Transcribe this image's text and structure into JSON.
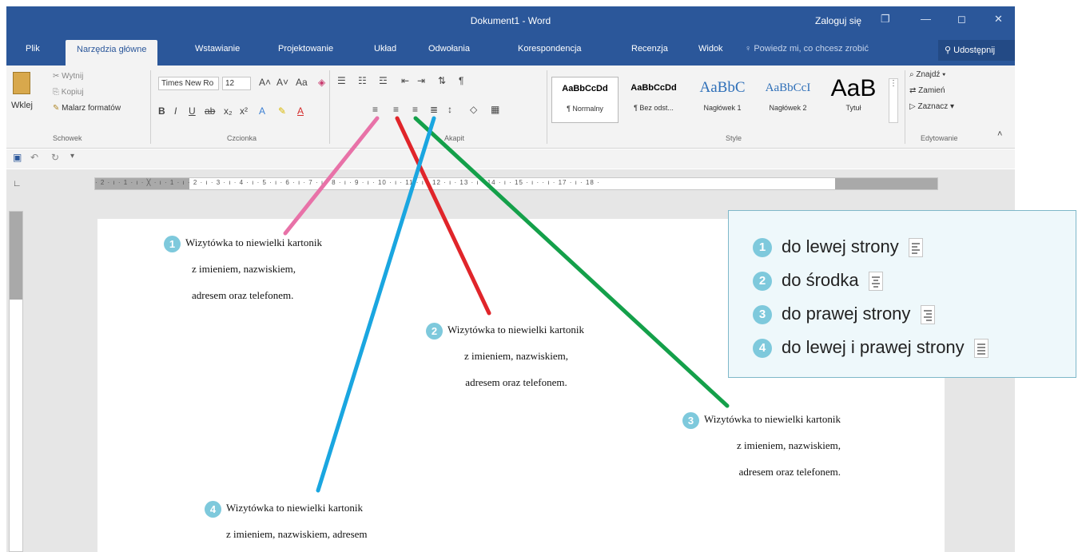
{
  "titlebar": {
    "title": "Dokument1  -  Word",
    "login": "Zaloguj się",
    "restore": "❐",
    "minimize": "—",
    "maximize": "◻",
    "close": "✕"
  },
  "tabs": [
    "Plik",
    "Narzędzia główne",
    "Wstawianie",
    "Projektowanie",
    "Układ",
    "Odwołania",
    "Korespondencja",
    "Recenzja",
    "Widok"
  ],
  "tell_me": "Powiedz mi, co chcesz zrobić",
  "share": "Udostępnij",
  "ribbon": {
    "clipboard": {
      "paste": "Wklej",
      "cut": "Wytnij",
      "copy": "Kopiuj",
      "painter": "Malarz formatów",
      "group": "Schowek"
    },
    "font": {
      "name": "Times New Ro",
      "size": "12",
      "group": "Czcionka"
    },
    "paragraph": {
      "group": "Akapit"
    },
    "styles": {
      "group": "Style",
      "items": [
        {
          "sample": "AaBbCcDd",
          "name": "¶ Normalny"
        },
        {
          "sample": "AaBbCcDd",
          "name": "¶ Bez odst..."
        },
        {
          "sample": "AaBbC",
          "name": "Nagłówek 1"
        },
        {
          "sample": "AaBbCcI",
          "name": "Nagłówek 2"
        },
        {
          "sample": "AaB",
          "name": "Tytuł"
        }
      ]
    },
    "editing": {
      "find": "Znajdź",
      "replace": "Zamień",
      "select": "Zaznacz",
      "group": "Edytowanie"
    }
  },
  "ruler_numbers": "· 2 · ı · 1 · ı · ╳ · ı · 1 · ı · 2 · ı · 3 · ı · 4 · ı · 5 · ı · 6 · ı · 7 · ı · 8 · ı · 9 · ı · 10 · ı · 11 · ı · 12 · ı · 13 · ı · 14 · ı · 15 · ı ·   · ı · 17 · ı · 18 ·",
  "paragraphs": [
    {
      "num": "1",
      "lines": [
        "Wizytówka to niewielki kartonik",
        "z imieniem, nazwiskiem,",
        "adresem oraz telefonem."
      ]
    },
    {
      "num": "2",
      "lines": [
        "Wizytówka to niewielki kartonik",
        "z imieniem, nazwiskiem,",
        "adresem oraz telefonem."
      ]
    },
    {
      "num": "3",
      "lines": [
        "Wizytówka to niewielki kartonik",
        "z imieniem, nazwiskiem,",
        "adresem oraz telefonem."
      ]
    },
    {
      "num": "4",
      "lines": [
        "Wizytówka  to  niewielki  kartonik",
        "z imieniem,  nazwiskiem,  adresem"
      ]
    }
  ],
  "legend": [
    {
      "num": "1",
      "text": "do lewej strony"
    },
    {
      "num": "2",
      "text": "do środka"
    },
    {
      "num": "3",
      "text": "do prawej strony"
    },
    {
      "num": "4",
      "text": "do lewej i prawej strony"
    }
  ],
  "colors": {
    "word_blue": "#2b579a",
    "pink": "#e872a8",
    "red": "#e0252a",
    "green": "#14a04a",
    "cyan": "#1aa6e0",
    "badge": "#7ec9dc"
  },
  "icons": {
    "bullets": "☰",
    "pilcrow": "¶",
    "sort": "⇅",
    "find": "⌕",
    "save": "💾"
  }
}
